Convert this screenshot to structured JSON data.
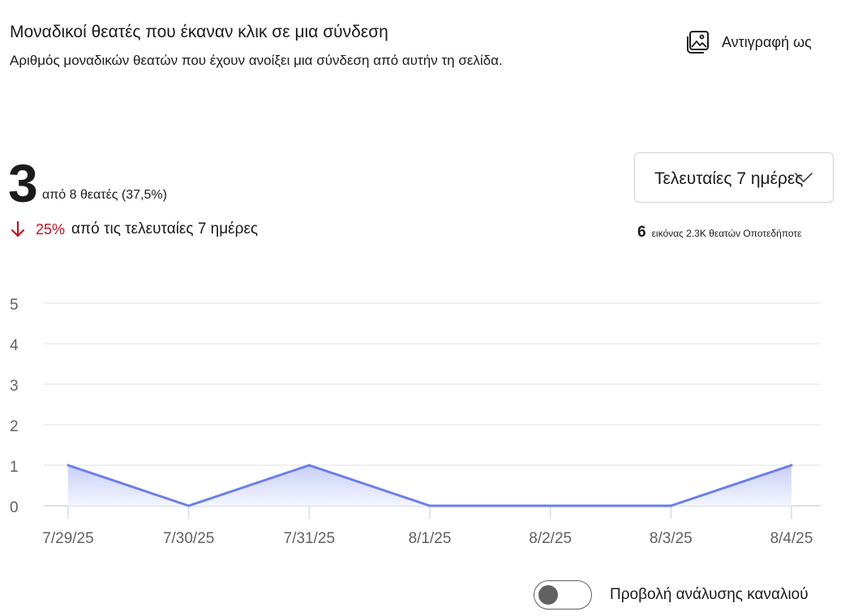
{
  "header": {
    "title": "Μοναδικοί θεατές που έκαναν κλικ σε μια σύνδεση",
    "subtitle": "Αριθμός μοναδικών θεατών που έχουν ανοίξει μια σύνδεση από αυτήν τη σελίδα.",
    "copy_as_label": "Αντιγραφή ως",
    "copy_as_icon": "image-copy-icon"
  },
  "metric": {
    "value": "3",
    "of_viewers": "από 8 θεατές (37,5%)",
    "change_pct": "25%",
    "change_direction": "down",
    "change_icon": "arrow-down-icon",
    "change_period": "από τις τελευταίες 7 ημέρες",
    "change_color": "#c50f1f"
  },
  "range_select": {
    "value": "Τελευταίες 7 ημέρες"
  },
  "summary": {
    "count": "6",
    "text": "εικόνας 2.3K θεατών Οποτεδήποτε"
  },
  "chart_data": {
    "type": "area",
    "categories": [
      "7/29/25",
      "7/30/25",
      "7/31/25",
      "8/1/25",
      "8/2/25",
      "8/3/25",
      "8/4/25"
    ],
    "series": [
      {
        "values": [
          1,
          0,
          1,
          0,
          0,
          0,
          1
        ]
      }
    ],
    "y_ticks": [
      "0",
      "1",
      "2",
      "3",
      "4",
      "5"
    ],
    "ylim": [
      0,
      5
    ],
    "grid": true,
    "line_color": "#6b7fe8",
    "fill_color_top": "#c9cff7",
    "fill_color_bottom": "#f4f5fe"
  },
  "channel_toggle": {
    "label": "Προβολή ανάλυσης καναλιού",
    "state": "off"
  }
}
